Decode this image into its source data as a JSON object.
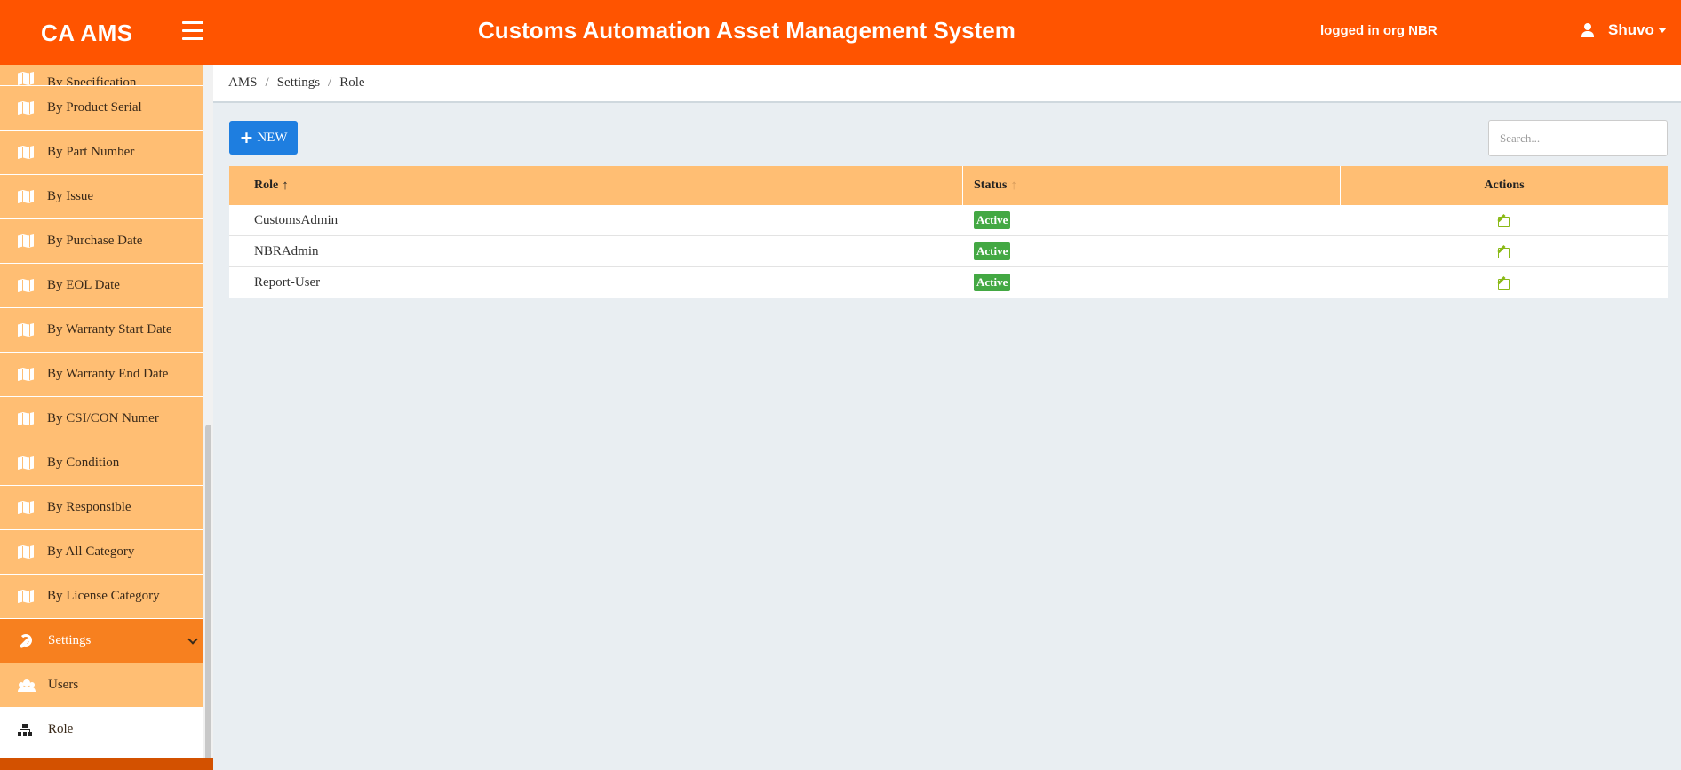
{
  "header": {
    "brand": "CA AMS",
    "app_title": "Customs Automation Asset Management System",
    "login_org": "logged in org NBR",
    "user_name": "Shuvo"
  },
  "sidebar": {
    "partial_item": "By Specification",
    "items": [
      {
        "label": "By Product Serial",
        "icon": "map-icon"
      },
      {
        "label": "By Part Number",
        "icon": "map-icon"
      },
      {
        "label": "By Issue",
        "icon": "map-icon"
      },
      {
        "label": "By Purchase Date",
        "icon": "map-icon"
      },
      {
        "label": "By EOL Date",
        "icon": "map-icon"
      },
      {
        "label": "By Warranty Start Date",
        "icon": "map-icon"
      },
      {
        "label": "By Warranty End Date",
        "icon": "map-icon"
      },
      {
        "label": "By CSI/CON Numer",
        "icon": "map-icon"
      },
      {
        "label": "By Condition",
        "icon": "map-icon"
      },
      {
        "label": "By Responsible",
        "icon": "map-icon"
      },
      {
        "label": "By All Category",
        "icon": "map-icon"
      },
      {
        "label": "By License Category",
        "icon": "map-icon"
      }
    ],
    "settings_label": "Settings",
    "users_label": "Users",
    "role_label": "Role"
  },
  "breadcrumb": [
    "AMS",
    "Settings",
    "Role"
  ],
  "toolbar": {
    "new_label": "NEW",
    "search_placeholder": "Search..."
  },
  "table": {
    "columns": {
      "role": "Role",
      "status": "Status",
      "actions": "Actions"
    },
    "rows": [
      {
        "role": "CustomsAdmin",
        "status": "Active"
      },
      {
        "role": "NBRAdmin",
        "status": "Active"
      },
      {
        "role": "Report-User",
        "status": "Active"
      }
    ]
  },
  "colors": {
    "header": "#ff5400",
    "sidebar_item": "#ffbe73",
    "settings_active": "#f7801f",
    "primary_button": "#1e7ee0",
    "status_active": "#43a843"
  }
}
